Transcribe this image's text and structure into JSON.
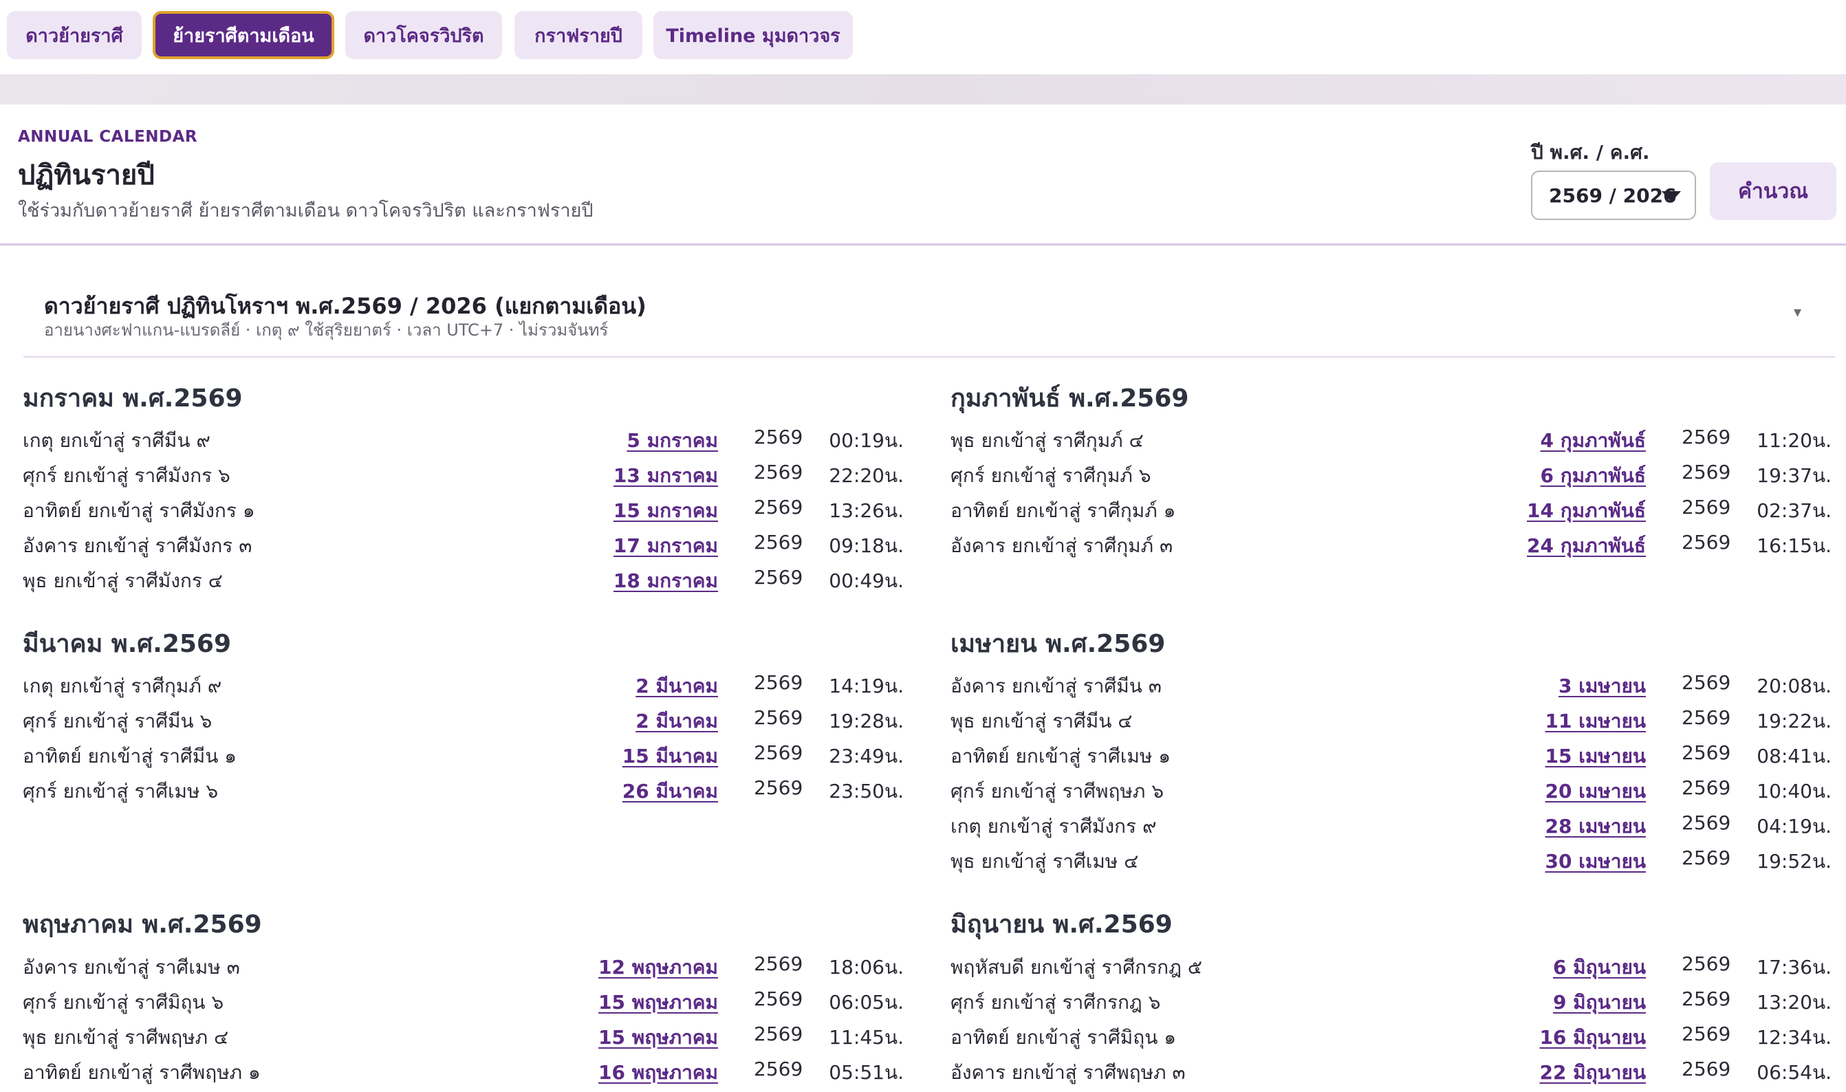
{
  "tabs": [
    {
      "label": "ดาวย้ายราศี"
    },
    {
      "label": "ย้ายราศีตามเดือน"
    },
    {
      "label": "ดาวโคจรวิปริต"
    },
    {
      "label": "กราฟรายปี"
    },
    {
      "label": "Timeline มุมดาวจร"
    }
  ],
  "header": {
    "eyebrow": "ANNUAL CALENDAR",
    "title": "ปฏิทินรายปี",
    "subtitle": "ใช้ร่วมกับดาวย้ายราศี ย้ายราศีตามเดือน ดาวโคจรวิปริต และกราฟรายปี",
    "year_label": "ปี พ.ศ. / ค.ศ.",
    "year_value": "2569 / 2026",
    "calc_button": "คำนวณ"
  },
  "panel": {
    "title": "ดาวย้ายราศี ปฏิทินโหราฯ พ.ศ.2569 / 2026 (แยกตามเดือน)",
    "subtitle": "อายนางศะฟาแกน-แบรดลีย์ · เกตุ ๙ ใช้สุริยยาตร์ · เวลา UTC+7 · ไม่รวมจันทร์",
    "toggle": "▾"
  },
  "months": [
    {
      "heading": "มกราคม พ.ศ.2569",
      "events": [
        {
          "event": "เกตุ ยกเข้าสู่ ราศีมีน ๙",
          "date": "5 มกราคม",
          "year": "2569",
          "time": "00:19น."
        },
        {
          "event": "ศุกร์ ยกเข้าสู่ ราศีมังกร ๖",
          "date": "13 มกราคม",
          "year": "2569",
          "time": "22:20น."
        },
        {
          "event": "อาทิตย์ ยกเข้าสู่ ราศีมังกร ๑",
          "date": "15 มกราคม",
          "year": "2569",
          "time": "13:26น."
        },
        {
          "event": "อังคาร ยกเข้าสู่ ราศีมังกร ๓",
          "date": "17 มกราคม",
          "year": "2569",
          "time": "09:18น."
        },
        {
          "event": "พุธ ยกเข้าสู่ ราศีมังกร ๔",
          "date": "18 มกราคม",
          "year": "2569",
          "time": "00:49น."
        }
      ]
    },
    {
      "heading": "กุมภาพันธ์ พ.ศ.2569",
      "events": [
        {
          "event": "พุธ ยกเข้าสู่ ราศีกุมภ์ ๔",
          "date": "4 กุมภาพันธ์",
          "year": "2569",
          "time": "11:20น."
        },
        {
          "event": "ศุกร์ ยกเข้าสู่ ราศีกุมภ์ ๖",
          "date": "6 กุมภาพันธ์",
          "year": "2569",
          "time": "19:37น."
        },
        {
          "event": "อาทิตย์ ยกเข้าสู่ ราศีกุมภ์ ๑",
          "date": "14 กุมภาพันธ์",
          "year": "2569",
          "time": "02:37น."
        },
        {
          "event": "อังคาร ยกเข้าสู่ ราศีกุมภ์ ๓",
          "date": "24 กุมภาพันธ์",
          "year": "2569",
          "time": "16:15น."
        }
      ]
    },
    {
      "heading": "มีนาคม พ.ศ.2569",
      "events": [
        {
          "event": "เกตุ ยกเข้าสู่ ราศีกุมภ์ ๙",
          "date": "2 มีนาคม",
          "year": "2569",
          "time": "14:19น."
        },
        {
          "event": "ศุกร์ ยกเข้าสู่ ราศีมีน ๖",
          "date": "2 มีนาคม",
          "year": "2569",
          "time": "19:28น."
        },
        {
          "event": "อาทิตย์ ยกเข้าสู่ ราศีมีน ๑",
          "date": "15 มีนาคม",
          "year": "2569",
          "time": "23:49น."
        },
        {
          "event": "ศุกร์ ยกเข้าสู่ ราศีเมษ ๖",
          "date": "26 มีนาคม",
          "year": "2569",
          "time": "23:50น."
        }
      ]
    },
    {
      "heading": "เมษายน พ.ศ.2569",
      "events": [
        {
          "event": "อังคาร ยกเข้าสู่ ราศีมีน ๓",
          "date": "3 เมษายน",
          "year": "2569",
          "time": "20:08น."
        },
        {
          "event": "พุธ ยกเข้าสู่ ราศีมีน ๔",
          "date": "11 เมษายน",
          "year": "2569",
          "time": "19:22น."
        },
        {
          "event": "อาทิตย์ ยกเข้าสู่ ราศีเมษ ๑",
          "date": "15 เมษายน",
          "year": "2569",
          "time": "08:41น."
        },
        {
          "event": "ศุกร์ ยกเข้าสู่ ราศีพฤษภ ๖",
          "date": "20 เมษายน",
          "year": "2569",
          "time": "10:40น."
        },
        {
          "event": "เกตุ ยกเข้าสู่ ราศีมังกร ๙",
          "date": "28 เมษายน",
          "year": "2569",
          "time": "04:19น."
        },
        {
          "event": "พุธ ยกเข้าสู่ ราศีเมษ ๔",
          "date": "30 เมษายน",
          "year": "2569",
          "time": "19:52น."
        }
      ]
    },
    {
      "heading": "พฤษภาคม พ.ศ.2569",
      "events": [
        {
          "event": "อังคาร ยกเข้าสู่ ราศีเมษ ๓",
          "date": "12 พฤษภาคม",
          "year": "2569",
          "time": "18:06น."
        },
        {
          "event": "ศุกร์ ยกเข้าสู่ ราศีมิถุน ๖",
          "date": "15 พฤษภาคม",
          "year": "2569",
          "time": "06:05น."
        },
        {
          "event": "พุธ ยกเข้าสู่ ราศีพฤษภ ๔",
          "date": "15 พฤษภาคม",
          "year": "2569",
          "time": "11:45น."
        },
        {
          "event": "อาทิตย์ ยกเข้าสู่ ราศีพฤษภ ๑",
          "date": "16 พฤษภาคม",
          "year": "2569",
          "time": "05:51น."
        }
      ]
    },
    {
      "heading": "มิถุนายน พ.ศ.2569",
      "events": [
        {
          "event": "พฤหัสบดี ยกเข้าสู่ ราศีกรกฎ ๕",
          "date": "6 มิถุนายน",
          "year": "2569",
          "time": "17:36น."
        },
        {
          "event": "ศุกร์ ยกเข้าสู่ ราศีกรกฎ ๖",
          "date": "9 มิถุนายน",
          "year": "2569",
          "time": "13:20น."
        },
        {
          "event": "อาทิตย์ ยกเข้าสู่ ราศีมิถุน ๑",
          "date": "16 มิถุนายน",
          "year": "2569",
          "time": "12:34น."
        },
        {
          "event": "อังคาร ยกเข้าสู่ ราศีพฤษภ ๓",
          "date": "22 มิถุนายน",
          "year": "2569",
          "time": "06:54น."
        }
      ]
    }
  ]
}
